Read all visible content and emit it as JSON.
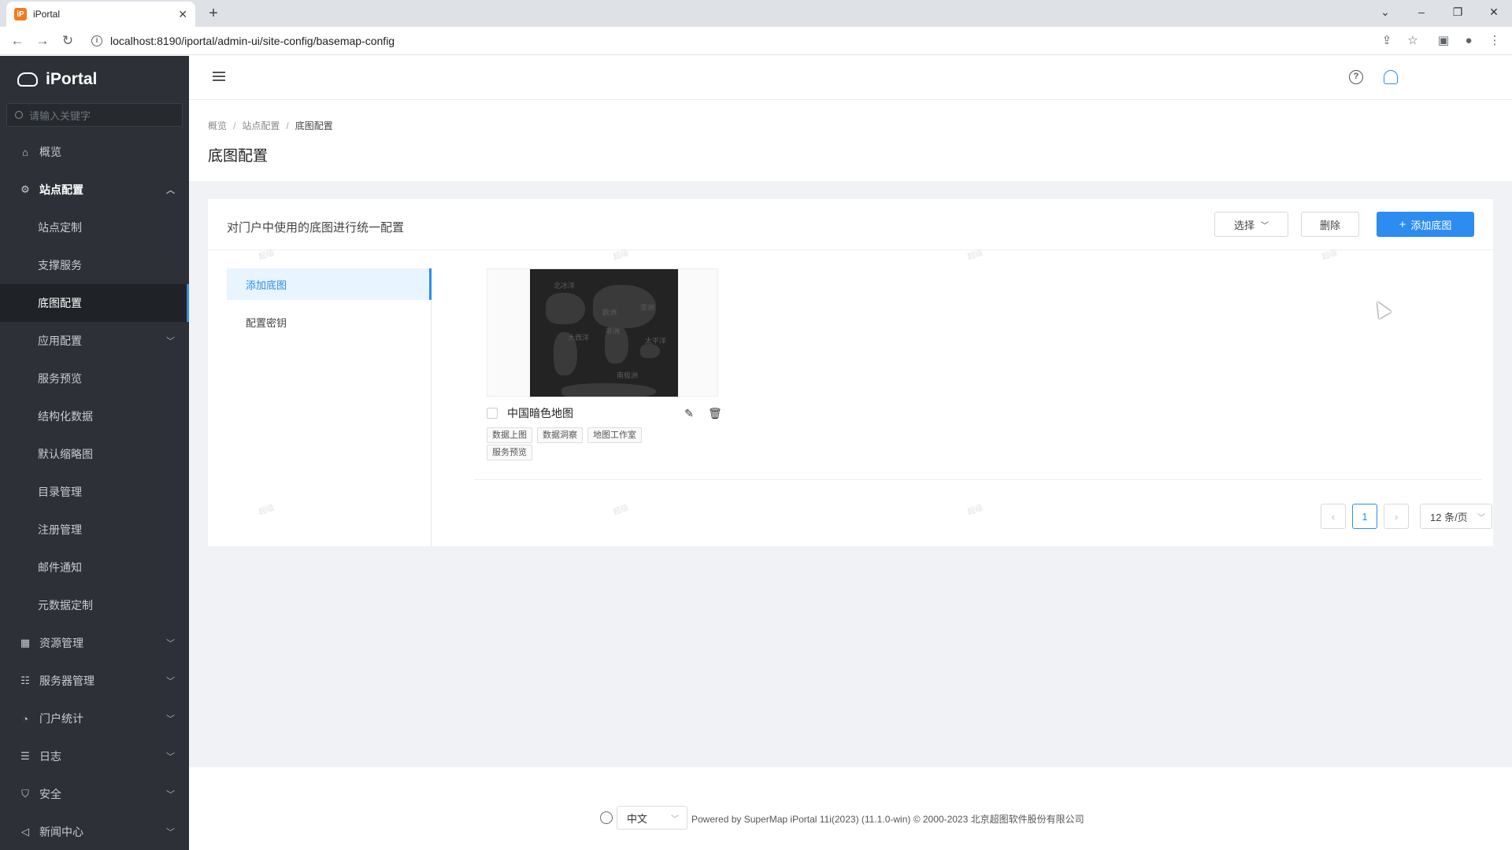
{
  "browser": {
    "tab_title": "iPortal",
    "tab_favicon": "iP",
    "url": "localhost:8190/iportal/admin-ui/site-config/basemap-config"
  },
  "sidebar": {
    "brand": "iPortal",
    "search_placeholder": "请输入关键字",
    "items": [
      {
        "label": "概览",
        "icon": "home-icon",
        "level": "top"
      },
      {
        "label": "站点配置",
        "icon": "gear-icon",
        "level": "top",
        "expanded": true
      },
      {
        "label": "站点定制",
        "level": "sub"
      },
      {
        "label": "支撑服务",
        "level": "sub"
      },
      {
        "label": "底图配置",
        "level": "sub",
        "active": true
      },
      {
        "label": "应用配置",
        "level": "sub",
        "has_children": true
      },
      {
        "label": "服务预览",
        "level": "sub"
      },
      {
        "label": "结构化数据",
        "level": "sub"
      },
      {
        "label": "默认缩略图",
        "level": "sub"
      },
      {
        "label": "目录管理",
        "level": "sub"
      },
      {
        "label": "注册管理",
        "level": "sub"
      },
      {
        "label": "邮件通知",
        "level": "sub"
      },
      {
        "label": "元数据定制",
        "level": "sub"
      },
      {
        "label": "资源管理",
        "icon": "grid-icon",
        "level": "top",
        "has_children": true
      },
      {
        "label": "服务器管理",
        "icon": "server-icon",
        "level": "top",
        "has_children": true
      },
      {
        "label": "门户统计",
        "icon": "chart-icon",
        "level": "top",
        "has_children": true
      },
      {
        "label": "日志",
        "icon": "log-icon",
        "level": "top",
        "has_children": true
      },
      {
        "label": "安全",
        "icon": "shield-icon",
        "level": "top",
        "has_children": true
      },
      {
        "label": "新闻中心",
        "icon": "megaphone-icon",
        "level": "top",
        "has_children": true
      }
    ]
  },
  "breadcrumb": [
    "概览",
    "站点配置",
    "底图配置"
  ],
  "page_title": "底图配置",
  "card": {
    "description": "对门户中使用的底图进行统一配置",
    "select_label": "选择",
    "delete_label": "删除",
    "add_label": "添加底图"
  },
  "left_nav": [
    "添加底图",
    "配置密钥"
  ],
  "basemap": {
    "name": "中国暗色地图",
    "tags": [
      "数据上图",
      "数据洞察",
      "地图工作室",
      "服务预览"
    ],
    "map_labels": [
      "北冰洋",
      "欧洲",
      "亚洲",
      "大西洋",
      "非洲",
      "太平洋",
      "南极洲"
    ]
  },
  "pagination": {
    "current_page": "1",
    "page_size": "12 条/页"
  },
  "watermark": "超级",
  "footer": {
    "language": "中文",
    "powered_by": "Powered by SuperMap iPortal 11i(2023) (11.1.0-win) © 2000-2023 北京超图软件股份有限公司"
  },
  "colors": {
    "accent": "#2d8cf0",
    "sidebar_bg": "#2d3137"
  }
}
